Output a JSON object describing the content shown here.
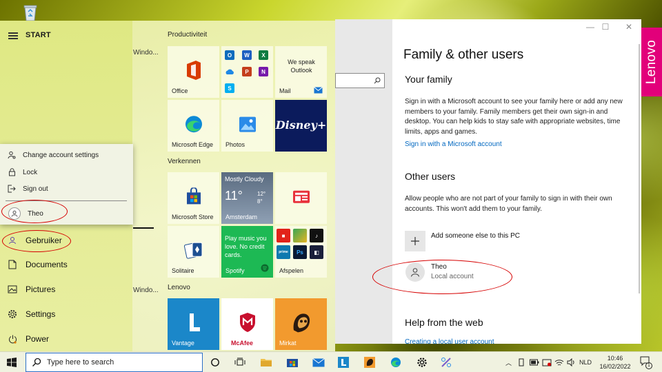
{
  "start": {
    "title": "START",
    "flyout": {
      "change_account": "Change account settings",
      "lock": "Lock",
      "sign_out": "Sign out",
      "user": "Theo"
    },
    "rail": {
      "user": "Gebruiker",
      "documents": "Documents",
      "pictures": "Pictures",
      "settings": "Settings",
      "power": "Power"
    },
    "ghost": [
      "Windo...",
      "Windo..."
    ],
    "groups": {
      "productiviteit": "Productiviteit",
      "verkennen": "Verkennen",
      "lenovo": "Lenovo"
    },
    "tiles": {
      "office": "Office",
      "mail_promo": "We speak Outlook",
      "mail": "Mail",
      "edge": "Microsoft Edge",
      "photos": "Photos",
      "disney": "Disney+",
      "store": "Microsoft Store",
      "weather_cond": "Mostly Cloudy",
      "weather_temp": "11°",
      "weather_hi": "12°",
      "weather_lo": "8°",
      "weather_city": "Amsterdam",
      "solitaire": "Solitaire",
      "spotify_msg": "Play music you love. No credit cards.",
      "spotify": "Spotify",
      "afspelen": "Afspelen",
      "vantage": "Vantage",
      "mcafee": "McAfee",
      "mirkat": "Mirkat"
    }
  },
  "settings": {
    "title": "Family & other users",
    "your_family_heading": "Your family",
    "your_family_text": "Sign in with a Microsoft account to see your family here or add any new members to your family. Family members get their own sign-in and desktop. You can help kids to stay safe with appropriate websites, time limits, apps and games.",
    "sign_in_link": "Sign in with a Microsoft account",
    "other_users_heading": "Other users",
    "other_users_text": "Allow people who are not part of your family to sign in with their own accounts. This won't add them to your family.",
    "add_someone": "Add someone else to this PC",
    "user_name": "Theo",
    "user_type": "Local account",
    "help_heading": "Help from the web",
    "help_link": "Creating a local user account"
  },
  "lenovo_badge": "Lenovo",
  "taskbar": {
    "search_placeholder": "Type here to search",
    "language": "NLD",
    "time": "10:46",
    "date": "16/02/2022",
    "notification_count": "1"
  },
  "colors": {
    "accent_link": "#0067c0",
    "annotation_red": "#d60000",
    "lenovo_pink": "#e2007a"
  }
}
